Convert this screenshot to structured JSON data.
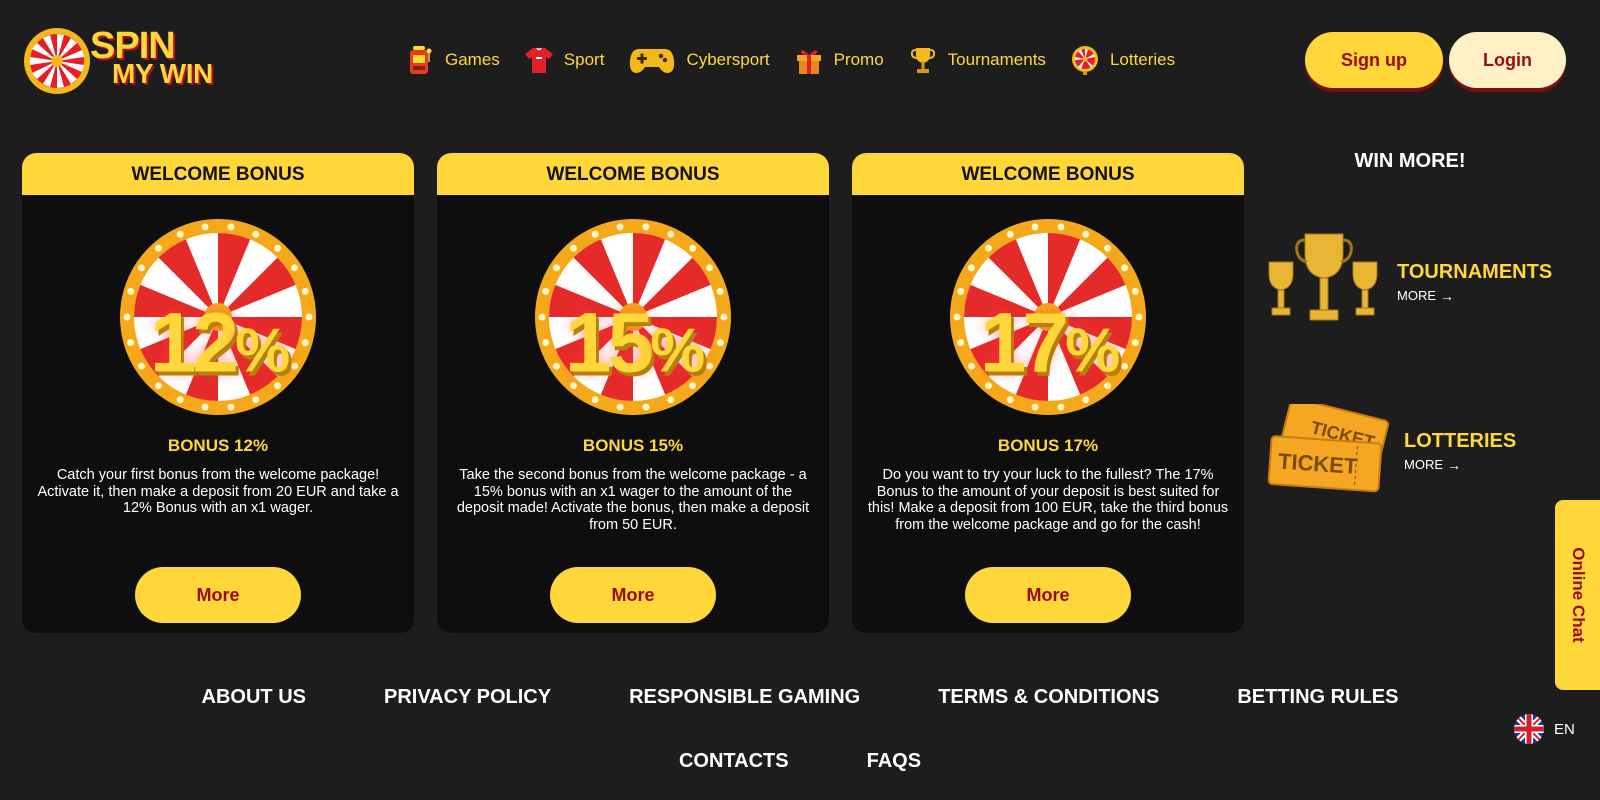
{
  "brand": {
    "line1": "SPIN",
    "line2": "MY WIN",
    "icon": "wheel-logo-icon"
  },
  "nav": [
    {
      "label": "Games",
      "icon": "slot-machine-icon"
    },
    {
      "label": "Sport",
      "icon": "jersey-icon"
    },
    {
      "label": "Cybersport",
      "icon": "gamepad-icon"
    },
    {
      "label": "Promo",
      "icon": "gift-icon"
    },
    {
      "label": "Tournaments",
      "icon": "trophy-icon"
    },
    {
      "label": "Lotteries",
      "icon": "wheel-icon"
    }
  ],
  "auth": {
    "signup": "Sign up",
    "login": "Login"
  },
  "cards": [
    {
      "header": "WELCOME BONUS",
      "percent": "12",
      "title": "BONUS 12%",
      "description": "Catch your first bonus from the welcome package! Activate it, then make a deposit from 20 EUR and take a 12% Bonus with an x1 wager.",
      "button": "More"
    },
    {
      "header": "WELCOME BONUS",
      "percent": "15",
      "title": "BONUS 15%",
      "description": "Take the second bonus from the welcome package - a 15% bonus with an x1 wager to the amount of the deposit made! Activate the bonus, then make a deposit from 50 EUR.",
      "button": "More"
    },
    {
      "header": "WELCOME BONUS",
      "percent": "17",
      "title": "BONUS 17%",
      "description": "Do you want to try your luck to the fullest? The 17% Bonus to the amount of your deposit is best suited for this! Make a deposit from 100 EUR, take the third bonus from the welcome package and go for the cash!",
      "button": "More"
    }
  ],
  "win_more": {
    "title": "WIN MORE!",
    "items": [
      {
        "title": "TOURNAMENTS",
        "more": "MORE",
        "icon": "trophies-icon"
      },
      {
        "title": "LOTTERIES",
        "more": "MORE",
        "icon": "tickets-icon"
      }
    ]
  },
  "online_chat": "Online Chat",
  "footer": {
    "row1": [
      "ABOUT US",
      "PRIVACY POLICY",
      "RESPONSIBLE GAMING",
      "TERMS & CONDITIONS",
      "BETTING RULES"
    ],
    "row2": [
      "CONTACTS",
      "FAQS"
    ]
  },
  "language": {
    "code": "EN",
    "icon": "uk-flag-icon"
  },
  "colors": {
    "accent": "#ffd73a",
    "button_text": "#9b0a16",
    "background": "#1d1d1d",
    "card_bg": "#0e0e0e"
  }
}
